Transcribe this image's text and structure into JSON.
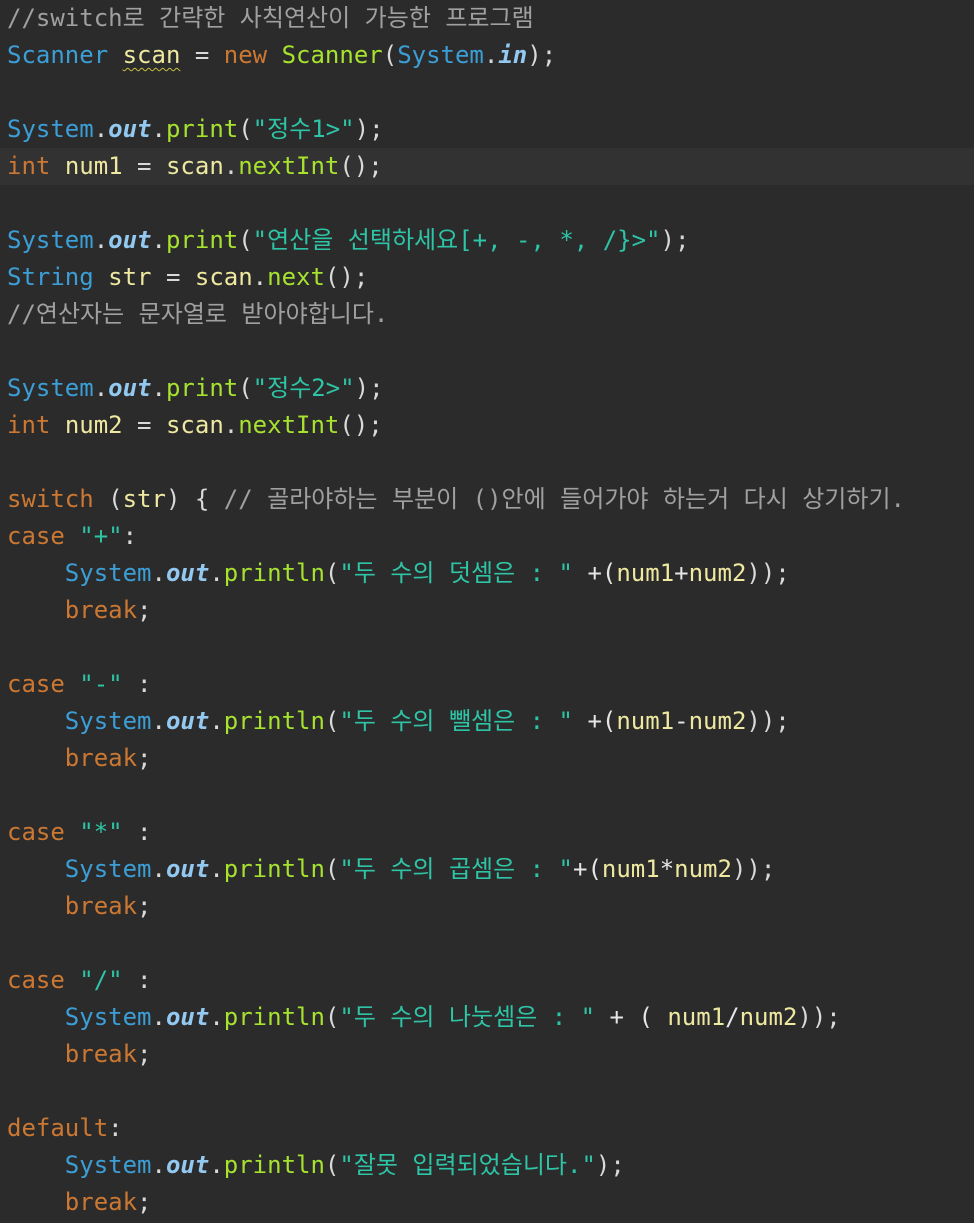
{
  "editor": {
    "language": "java",
    "indent_spaces": 4,
    "colors": {
      "background": "#2b2b2b",
      "current_line": "#323232",
      "comment": "#a0a0a0",
      "type": "#3c9ed6",
      "keyword": "#cc7832",
      "variable": "#eee8a0",
      "string": "#2ec4a6",
      "field": "#93c8f0",
      "method": "#a6e22e",
      "plain": "#d9d9d9"
    },
    "lines": [
      {
        "tokens": [
          {
            "t": "//switch로 간략한 사칙연산이 가능한 프로그램",
            "k": "cm"
          }
        ]
      },
      {
        "tokens": [
          {
            "t": "Scanner",
            "k": "ty"
          },
          {
            "t": " ",
            "k": "pl"
          },
          {
            "t": "scan",
            "k": "va",
            "warn": true
          },
          {
            "t": " = ",
            "k": "pl"
          },
          {
            "t": "new",
            "k": "kw"
          },
          {
            "t": " ",
            "k": "pl"
          },
          {
            "t": "Scanner",
            "k": "me"
          },
          {
            "t": "(",
            "k": "pl"
          },
          {
            "t": "System",
            "k": "ty"
          },
          {
            "t": ".",
            "k": "pl"
          },
          {
            "t": "in",
            "k": "fi"
          },
          {
            "t": ");",
            "k": "pl"
          }
        ]
      },
      {
        "tokens": []
      },
      {
        "tokens": [
          {
            "t": "System",
            "k": "ty"
          },
          {
            "t": ".",
            "k": "pl"
          },
          {
            "t": "out",
            "k": "fi"
          },
          {
            "t": ".",
            "k": "pl"
          },
          {
            "t": "print",
            "k": "me"
          },
          {
            "t": "(",
            "k": "pl"
          },
          {
            "t": "\"정수1>\"",
            "k": "st"
          },
          {
            "t": ");",
            "k": "pl"
          }
        ]
      },
      {
        "current": true,
        "tokens": [
          {
            "t": "int",
            "k": "kw"
          },
          {
            "t": " ",
            "k": "pl"
          },
          {
            "t": "num1",
            "k": "va"
          },
          {
            "t": " = ",
            "k": "pl"
          },
          {
            "t": "scan",
            "k": "va"
          },
          {
            "t": ".",
            "k": "pl"
          },
          {
            "t": "nextInt",
            "k": "me"
          },
          {
            "t": "();",
            "k": "pl"
          }
        ]
      },
      {
        "tokens": []
      },
      {
        "tokens": [
          {
            "t": "System",
            "k": "ty"
          },
          {
            "t": ".",
            "k": "pl"
          },
          {
            "t": "out",
            "k": "fi"
          },
          {
            "t": ".",
            "k": "pl"
          },
          {
            "t": "print",
            "k": "me"
          },
          {
            "t": "(",
            "k": "pl"
          },
          {
            "t": "\"연산을 선택하세요[+, -, *, /}>\"",
            "k": "st"
          },
          {
            "t": ");",
            "k": "pl"
          }
        ]
      },
      {
        "tokens": [
          {
            "t": "String",
            "k": "ty"
          },
          {
            "t": " ",
            "k": "pl"
          },
          {
            "t": "str",
            "k": "va"
          },
          {
            "t": " = ",
            "k": "pl"
          },
          {
            "t": "scan",
            "k": "va"
          },
          {
            "t": ".",
            "k": "pl"
          },
          {
            "t": "next",
            "k": "me"
          },
          {
            "t": "();",
            "k": "pl"
          }
        ]
      },
      {
        "tokens": [
          {
            "t": "//연산자는 문자열로 받아야합니다.",
            "k": "cm"
          }
        ]
      },
      {
        "tokens": []
      },
      {
        "tokens": [
          {
            "t": "System",
            "k": "ty"
          },
          {
            "t": ".",
            "k": "pl"
          },
          {
            "t": "out",
            "k": "fi"
          },
          {
            "t": ".",
            "k": "pl"
          },
          {
            "t": "print",
            "k": "me"
          },
          {
            "t": "(",
            "k": "pl"
          },
          {
            "t": "\"정수2>\"",
            "k": "st"
          },
          {
            "t": ");",
            "k": "pl"
          }
        ]
      },
      {
        "tokens": [
          {
            "t": "int",
            "k": "kw"
          },
          {
            "t": " ",
            "k": "pl"
          },
          {
            "t": "num2",
            "k": "va"
          },
          {
            "t": " = ",
            "k": "pl"
          },
          {
            "t": "scan",
            "k": "va"
          },
          {
            "t": ".",
            "k": "pl"
          },
          {
            "t": "nextInt",
            "k": "me"
          },
          {
            "t": "();",
            "k": "pl"
          }
        ]
      },
      {
        "tokens": []
      },
      {
        "tokens": [
          {
            "t": "switch",
            "k": "kw"
          },
          {
            "t": " (",
            "k": "pl"
          },
          {
            "t": "str",
            "k": "va"
          },
          {
            "t": ") { ",
            "k": "pl"
          },
          {
            "t": "// 골라야하는 부분이 ()안에 들어가야 하는거 다시 상기하기.",
            "k": "cm"
          }
        ]
      },
      {
        "tokens": [
          {
            "t": "case",
            "k": "kw"
          },
          {
            "t": " ",
            "k": "pl"
          },
          {
            "t": "\"+\"",
            "k": "st"
          },
          {
            "t": ":",
            "k": "pl"
          }
        ]
      },
      {
        "tokens": [
          {
            "t": "    ",
            "k": "pl"
          },
          {
            "t": "System",
            "k": "ty"
          },
          {
            "t": ".",
            "k": "pl"
          },
          {
            "t": "out",
            "k": "fi"
          },
          {
            "t": ".",
            "k": "pl"
          },
          {
            "t": "println",
            "k": "me"
          },
          {
            "t": "(",
            "k": "pl"
          },
          {
            "t": "\"두 수의 덧셈은 : \"",
            "k": "st"
          },
          {
            "t": " +(",
            "k": "pr"
          },
          {
            "t": "num1",
            "k": "va"
          },
          {
            "t": "+",
            "k": "pr"
          },
          {
            "t": "num2",
            "k": "va"
          },
          {
            "t": "));",
            "k": "pl"
          }
        ]
      },
      {
        "tokens": [
          {
            "t": "    ",
            "k": "pl"
          },
          {
            "t": "break",
            "k": "kw"
          },
          {
            "t": ";",
            "k": "pl"
          }
        ]
      },
      {
        "tokens": []
      },
      {
        "tokens": [
          {
            "t": "case",
            "k": "kw"
          },
          {
            "t": " ",
            "k": "pl"
          },
          {
            "t": "\"-\"",
            "k": "st"
          },
          {
            "t": " :",
            "k": "pl"
          }
        ]
      },
      {
        "tokens": [
          {
            "t": "    ",
            "k": "pl"
          },
          {
            "t": "System",
            "k": "ty"
          },
          {
            "t": ".",
            "k": "pl"
          },
          {
            "t": "out",
            "k": "fi"
          },
          {
            "t": ".",
            "k": "pl"
          },
          {
            "t": "println",
            "k": "me"
          },
          {
            "t": "(",
            "k": "pl"
          },
          {
            "t": "\"두 수의 뺄셈은 : \"",
            "k": "st"
          },
          {
            "t": " +(",
            "k": "pr"
          },
          {
            "t": "num1",
            "k": "va"
          },
          {
            "t": "-",
            "k": "pr"
          },
          {
            "t": "num2",
            "k": "va"
          },
          {
            "t": "));",
            "k": "pl"
          }
        ]
      },
      {
        "tokens": [
          {
            "t": "    ",
            "k": "pl"
          },
          {
            "t": "break",
            "k": "kw"
          },
          {
            "t": ";",
            "k": "pl"
          }
        ]
      },
      {
        "tokens": []
      },
      {
        "tokens": [
          {
            "t": "case",
            "k": "kw"
          },
          {
            "t": " ",
            "k": "pl"
          },
          {
            "t": "\"*\"",
            "k": "st"
          },
          {
            "t": " :",
            "k": "pl"
          }
        ]
      },
      {
        "tokens": [
          {
            "t": "    ",
            "k": "pl"
          },
          {
            "t": "System",
            "k": "ty"
          },
          {
            "t": ".",
            "k": "pl"
          },
          {
            "t": "out",
            "k": "fi"
          },
          {
            "t": ".",
            "k": "pl"
          },
          {
            "t": "println",
            "k": "me"
          },
          {
            "t": "(",
            "k": "pl"
          },
          {
            "t": "\"두 수의 곱셈은 : \"",
            "k": "st"
          },
          {
            "t": "+(",
            "k": "pr"
          },
          {
            "t": "num1",
            "k": "va"
          },
          {
            "t": "*",
            "k": "pr"
          },
          {
            "t": "num2",
            "k": "va"
          },
          {
            "t": "));",
            "k": "pl"
          }
        ]
      },
      {
        "tokens": [
          {
            "t": "    ",
            "k": "pl"
          },
          {
            "t": "break",
            "k": "kw"
          },
          {
            "t": ";",
            "k": "pl"
          }
        ]
      },
      {
        "tokens": []
      },
      {
        "tokens": [
          {
            "t": "case",
            "k": "kw"
          },
          {
            "t": " ",
            "k": "pl"
          },
          {
            "t": "\"/\"",
            "k": "st"
          },
          {
            "t": " :",
            "k": "pl"
          }
        ]
      },
      {
        "tokens": [
          {
            "t": "    ",
            "k": "pl"
          },
          {
            "t": "System",
            "k": "ty"
          },
          {
            "t": ".",
            "k": "pl"
          },
          {
            "t": "out",
            "k": "fi"
          },
          {
            "t": ".",
            "k": "pl"
          },
          {
            "t": "println",
            "k": "me"
          },
          {
            "t": "(",
            "k": "pl"
          },
          {
            "t": "\"두 수의 나눗셈은 : \"",
            "k": "st"
          },
          {
            "t": " + ( ",
            "k": "pr"
          },
          {
            "t": "num1",
            "k": "va"
          },
          {
            "t": "/",
            "k": "pr"
          },
          {
            "t": "num2",
            "k": "va"
          },
          {
            "t": "));",
            "k": "pl"
          }
        ]
      },
      {
        "tokens": [
          {
            "t": "    ",
            "k": "pl"
          },
          {
            "t": "break",
            "k": "kw"
          },
          {
            "t": ";",
            "k": "pl"
          }
        ]
      },
      {
        "tokens": []
      },
      {
        "tokens": [
          {
            "t": "default",
            "k": "kw"
          },
          {
            "t": ":",
            "k": "pl"
          }
        ]
      },
      {
        "tokens": [
          {
            "t": "    ",
            "k": "pl"
          },
          {
            "t": "System",
            "k": "ty"
          },
          {
            "t": ".",
            "k": "pl"
          },
          {
            "t": "out",
            "k": "fi"
          },
          {
            "t": ".",
            "k": "pl"
          },
          {
            "t": "println",
            "k": "me"
          },
          {
            "t": "(",
            "k": "pl"
          },
          {
            "t": "\"잘못 입력되었습니다.\"",
            "k": "st"
          },
          {
            "t": ");",
            "k": "pl"
          }
        ]
      },
      {
        "tokens": [
          {
            "t": "    ",
            "k": "pl"
          },
          {
            "t": "break",
            "k": "kw"
          },
          {
            "t": ";",
            "k": "pl"
          }
        ]
      }
    ]
  }
}
